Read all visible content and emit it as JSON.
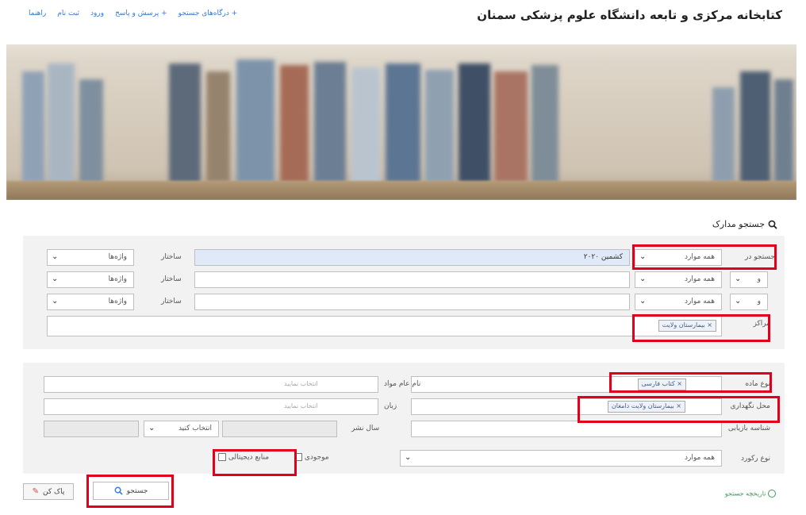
{
  "header": {
    "site_title": "کتابخانه مرکزی و تابعه دانشگاه علوم پزشکی سمنان",
    "nav": [
      "درگاه‌های جستجو +",
      "پرسش و پاسخ +",
      "ورود",
      "ثبت نام",
      "راهنما"
    ]
  },
  "search": {
    "title": "جستجو مدارک",
    "search_in_label": "جستجو در",
    "structure_label": "ساختار",
    "structure_value": "واژه‌ها",
    "all_items": "همه موارد",
    "and_op": "و",
    "query_value": "کشمین ۲۰۲۰",
    "centers_label": "مراکز",
    "centers_tag": "بیمارستان ولایت"
  },
  "filters": {
    "material_type_label": "نوع ماده",
    "material_type_tag": "کتاب فارسی",
    "general_material_label": "نام عام مواد",
    "select_placeholder": "انتخاب نمایید",
    "storage_label": "محل نگهداری",
    "storage_tag": "بیمارستان ولایت دامغان",
    "language_label": "زبان",
    "accession_label": "شناسه بازیابی",
    "pub_year_label": "سال نشر",
    "choose_label": "انتخاب کنید",
    "record_type_label": "نوع رکورد",
    "record_type_value": "همه موارد",
    "available_label": "موجودی",
    "digital_label": "منابع دیجیتالی"
  },
  "actions": {
    "history_link": "تاریخچه جستجو",
    "search_button": "جستجو",
    "clear_button": "پاک کن"
  }
}
